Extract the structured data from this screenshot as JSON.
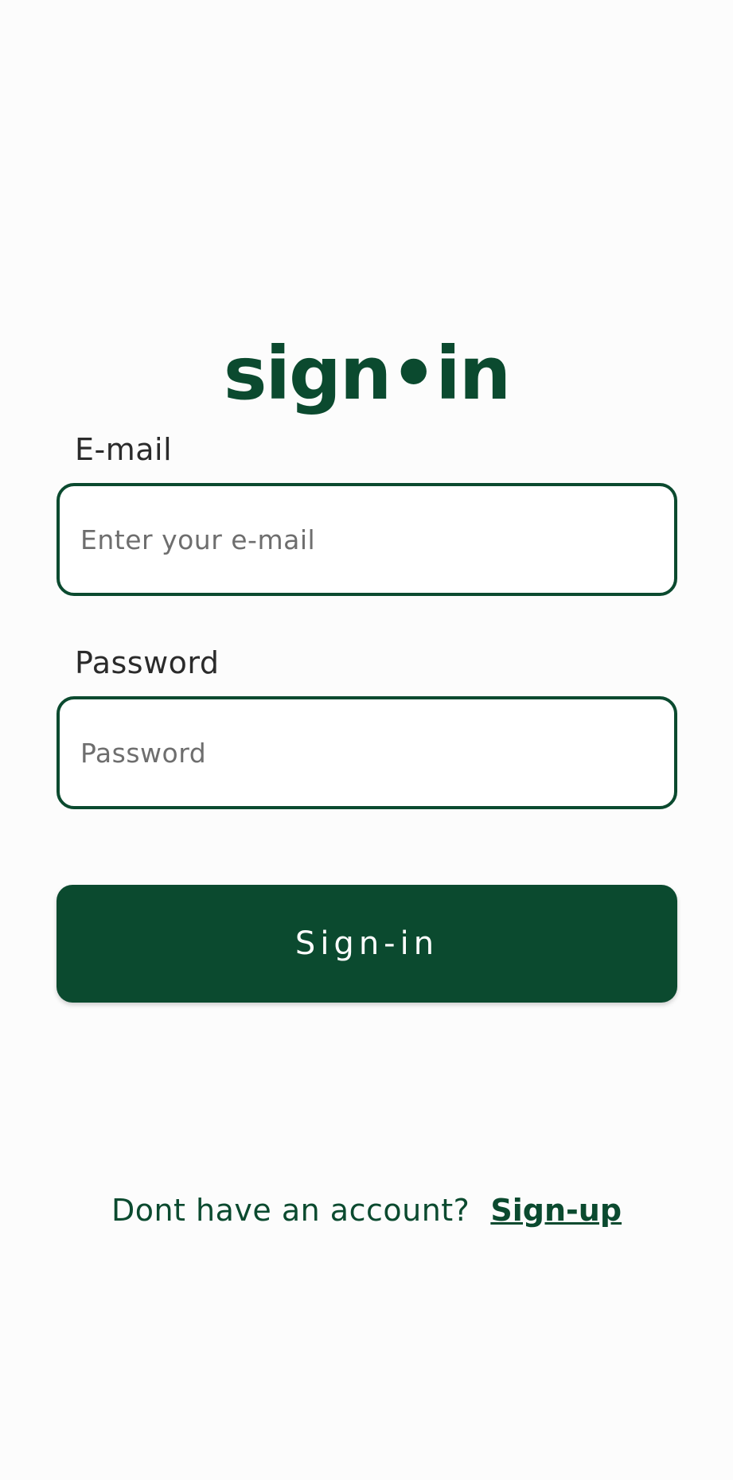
{
  "app": {
    "logo_text": "sign•in"
  },
  "form": {
    "email": {
      "label": "E-mail",
      "placeholder": "Enter your e-mail",
      "value": ""
    },
    "password": {
      "label": "Password",
      "placeholder": "Password",
      "value": ""
    },
    "submit_label": "Sign-in"
  },
  "footer": {
    "prompt": "Dont have an account?",
    "link_label": "Sign-up"
  },
  "colors": {
    "accent": "#0b4a2f",
    "background": "#fcfcfc",
    "label_text": "#2b2b2b",
    "placeholder_text": "#6e6e6e"
  }
}
